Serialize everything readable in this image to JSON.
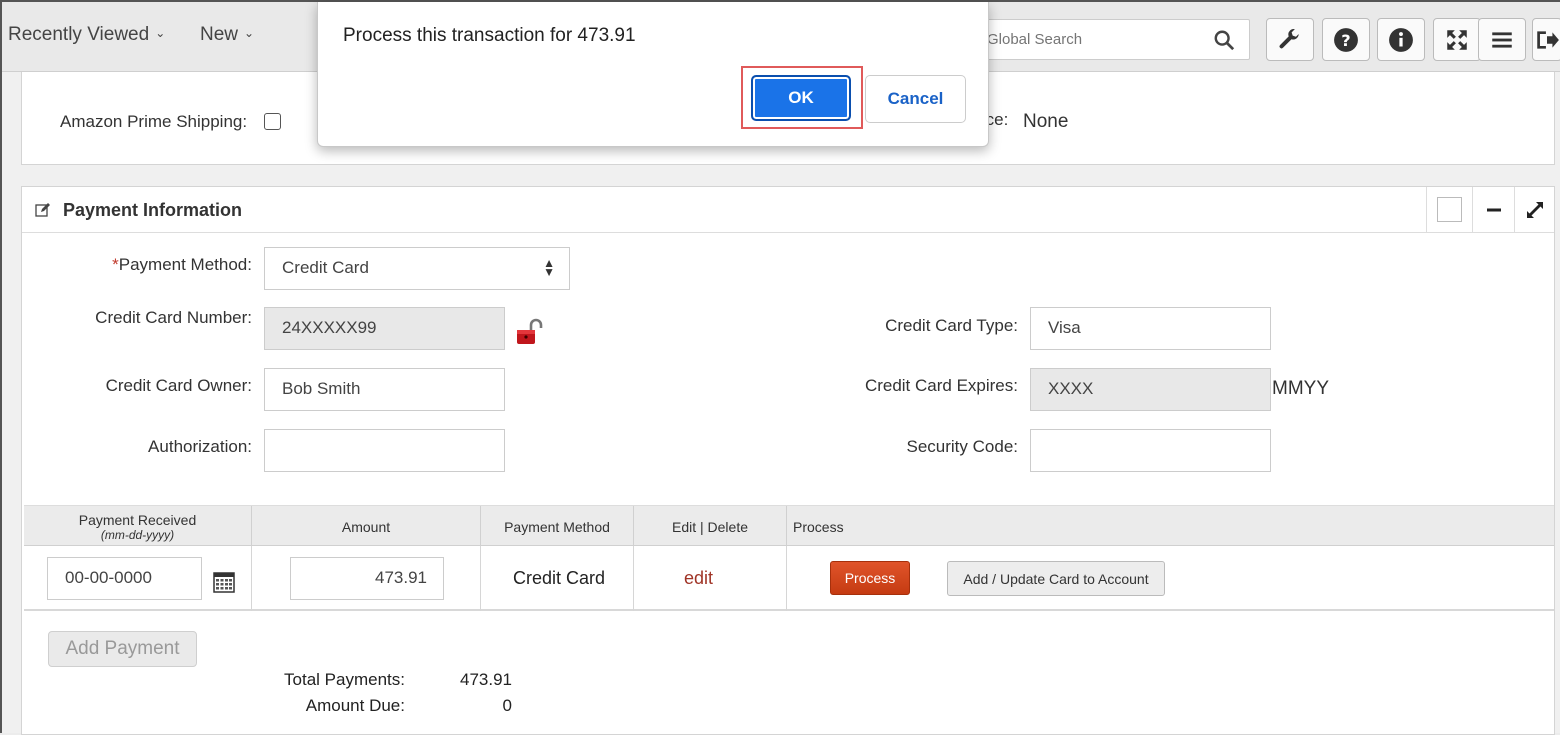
{
  "nav": {
    "recently_viewed": "Recently Viewed",
    "new": "New",
    "search_placeholder": "Global Search"
  },
  "toolbar": {
    "icons": [
      "wrench-icon",
      "help-icon",
      "info-icon",
      "expand-icon",
      "menu-icon",
      "logout-icon"
    ]
  },
  "top_section": {
    "amazon_prime_label": "Amazon Prime Shipping:",
    "source_label_partial": "rce:",
    "source_value": "None"
  },
  "payment": {
    "title": "Payment Information",
    "method_label": "Payment Method:",
    "method_required_mark": "*",
    "method_value": "Credit Card",
    "cc_number_label": "Credit Card Number:",
    "cc_number_value": "24XXXXX99",
    "cc_owner_label": "Credit Card Owner:",
    "cc_owner_value": "Bob Smith",
    "authorization_label": "Authorization:",
    "authorization_value": "",
    "cc_type_label": "Credit Card Type:",
    "cc_type_value": "Visa",
    "cc_expires_label": "Credit Card Expires:",
    "cc_expires_value": "XXXX",
    "cc_expires_hint": "MMYY",
    "security_code_label": "Security Code:",
    "security_code_value": ""
  },
  "table": {
    "headers": {
      "received": "Payment Received",
      "received_sub": "(mm-dd-yyyy)",
      "amount": "Amount",
      "method": "Payment Method",
      "edit_delete": "Edit | Delete",
      "process": "Process"
    },
    "row": {
      "date": "00-00-0000",
      "amount": "473.91",
      "method": "Credit Card",
      "edit": "edit",
      "process_btn": "Process",
      "add_card_btn": "Add / Update Card to Account"
    }
  },
  "totals": {
    "add_payment": "Add Payment",
    "total_label": "Total Payments:",
    "total_value": "473.91",
    "due_label": "Amount Due:",
    "due_value": "0"
  },
  "dialog": {
    "message": "Process this transaction for 473.91",
    "ok": "OK",
    "cancel": "Cancel"
  },
  "colors": {
    "accent_blue": "#1a73e8",
    "process_orange": "#d2461c",
    "link_red": "#a03426"
  }
}
